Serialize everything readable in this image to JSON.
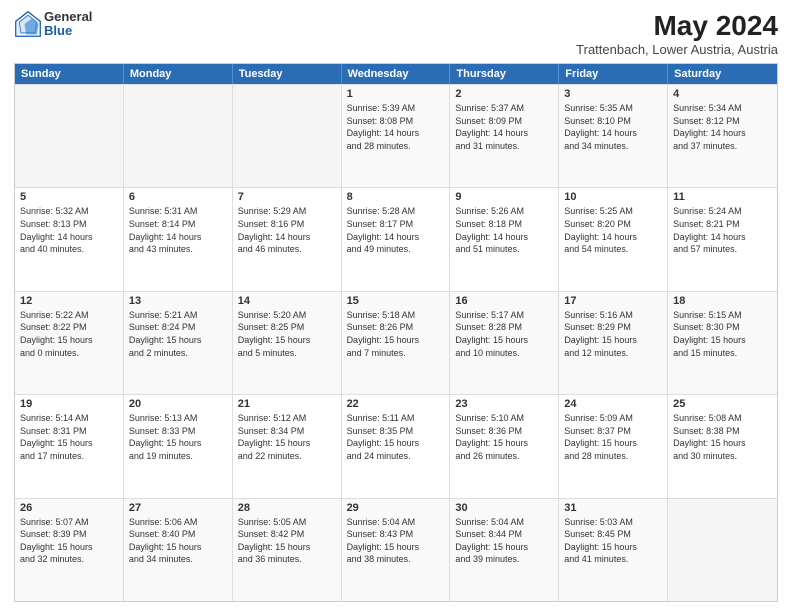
{
  "header": {
    "logo": {
      "general": "General",
      "blue": "Blue"
    },
    "title": "May 2024",
    "location": "Trattenbach, Lower Austria, Austria"
  },
  "days_of_week": [
    "Sunday",
    "Monday",
    "Tuesday",
    "Wednesday",
    "Thursday",
    "Friday",
    "Saturday"
  ],
  "weeks": [
    [
      {
        "day": "",
        "content": ""
      },
      {
        "day": "",
        "content": ""
      },
      {
        "day": "",
        "content": ""
      },
      {
        "day": "1",
        "content": "Sunrise: 5:39 AM\nSunset: 8:08 PM\nDaylight: 14 hours\nand 28 minutes."
      },
      {
        "day": "2",
        "content": "Sunrise: 5:37 AM\nSunset: 8:09 PM\nDaylight: 14 hours\nand 31 minutes."
      },
      {
        "day": "3",
        "content": "Sunrise: 5:35 AM\nSunset: 8:10 PM\nDaylight: 14 hours\nand 34 minutes."
      },
      {
        "day": "4",
        "content": "Sunrise: 5:34 AM\nSunset: 8:12 PM\nDaylight: 14 hours\nand 37 minutes."
      }
    ],
    [
      {
        "day": "5",
        "content": "Sunrise: 5:32 AM\nSunset: 8:13 PM\nDaylight: 14 hours\nand 40 minutes."
      },
      {
        "day": "6",
        "content": "Sunrise: 5:31 AM\nSunset: 8:14 PM\nDaylight: 14 hours\nand 43 minutes."
      },
      {
        "day": "7",
        "content": "Sunrise: 5:29 AM\nSunset: 8:16 PM\nDaylight: 14 hours\nand 46 minutes."
      },
      {
        "day": "8",
        "content": "Sunrise: 5:28 AM\nSunset: 8:17 PM\nDaylight: 14 hours\nand 49 minutes."
      },
      {
        "day": "9",
        "content": "Sunrise: 5:26 AM\nSunset: 8:18 PM\nDaylight: 14 hours\nand 51 minutes."
      },
      {
        "day": "10",
        "content": "Sunrise: 5:25 AM\nSunset: 8:20 PM\nDaylight: 14 hours\nand 54 minutes."
      },
      {
        "day": "11",
        "content": "Sunrise: 5:24 AM\nSunset: 8:21 PM\nDaylight: 14 hours\nand 57 minutes."
      }
    ],
    [
      {
        "day": "12",
        "content": "Sunrise: 5:22 AM\nSunset: 8:22 PM\nDaylight: 15 hours\nand 0 minutes."
      },
      {
        "day": "13",
        "content": "Sunrise: 5:21 AM\nSunset: 8:24 PM\nDaylight: 15 hours\nand 2 minutes."
      },
      {
        "day": "14",
        "content": "Sunrise: 5:20 AM\nSunset: 8:25 PM\nDaylight: 15 hours\nand 5 minutes."
      },
      {
        "day": "15",
        "content": "Sunrise: 5:18 AM\nSunset: 8:26 PM\nDaylight: 15 hours\nand 7 minutes."
      },
      {
        "day": "16",
        "content": "Sunrise: 5:17 AM\nSunset: 8:28 PM\nDaylight: 15 hours\nand 10 minutes."
      },
      {
        "day": "17",
        "content": "Sunrise: 5:16 AM\nSunset: 8:29 PM\nDaylight: 15 hours\nand 12 minutes."
      },
      {
        "day": "18",
        "content": "Sunrise: 5:15 AM\nSunset: 8:30 PM\nDaylight: 15 hours\nand 15 minutes."
      }
    ],
    [
      {
        "day": "19",
        "content": "Sunrise: 5:14 AM\nSunset: 8:31 PM\nDaylight: 15 hours\nand 17 minutes."
      },
      {
        "day": "20",
        "content": "Sunrise: 5:13 AM\nSunset: 8:33 PM\nDaylight: 15 hours\nand 19 minutes."
      },
      {
        "day": "21",
        "content": "Sunrise: 5:12 AM\nSunset: 8:34 PM\nDaylight: 15 hours\nand 22 minutes."
      },
      {
        "day": "22",
        "content": "Sunrise: 5:11 AM\nSunset: 8:35 PM\nDaylight: 15 hours\nand 24 minutes."
      },
      {
        "day": "23",
        "content": "Sunrise: 5:10 AM\nSunset: 8:36 PM\nDaylight: 15 hours\nand 26 minutes."
      },
      {
        "day": "24",
        "content": "Sunrise: 5:09 AM\nSunset: 8:37 PM\nDaylight: 15 hours\nand 28 minutes."
      },
      {
        "day": "25",
        "content": "Sunrise: 5:08 AM\nSunset: 8:38 PM\nDaylight: 15 hours\nand 30 minutes."
      }
    ],
    [
      {
        "day": "26",
        "content": "Sunrise: 5:07 AM\nSunset: 8:39 PM\nDaylight: 15 hours\nand 32 minutes."
      },
      {
        "day": "27",
        "content": "Sunrise: 5:06 AM\nSunset: 8:40 PM\nDaylight: 15 hours\nand 34 minutes."
      },
      {
        "day": "28",
        "content": "Sunrise: 5:05 AM\nSunset: 8:42 PM\nDaylight: 15 hours\nand 36 minutes."
      },
      {
        "day": "29",
        "content": "Sunrise: 5:04 AM\nSunset: 8:43 PM\nDaylight: 15 hours\nand 38 minutes."
      },
      {
        "day": "30",
        "content": "Sunrise: 5:04 AM\nSunset: 8:44 PM\nDaylight: 15 hours\nand 39 minutes."
      },
      {
        "day": "31",
        "content": "Sunrise: 5:03 AM\nSunset: 8:45 PM\nDaylight: 15 hours\nand 41 minutes."
      },
      {
        "day": "",
        "content": ""
      }
    ]
  ]
}
